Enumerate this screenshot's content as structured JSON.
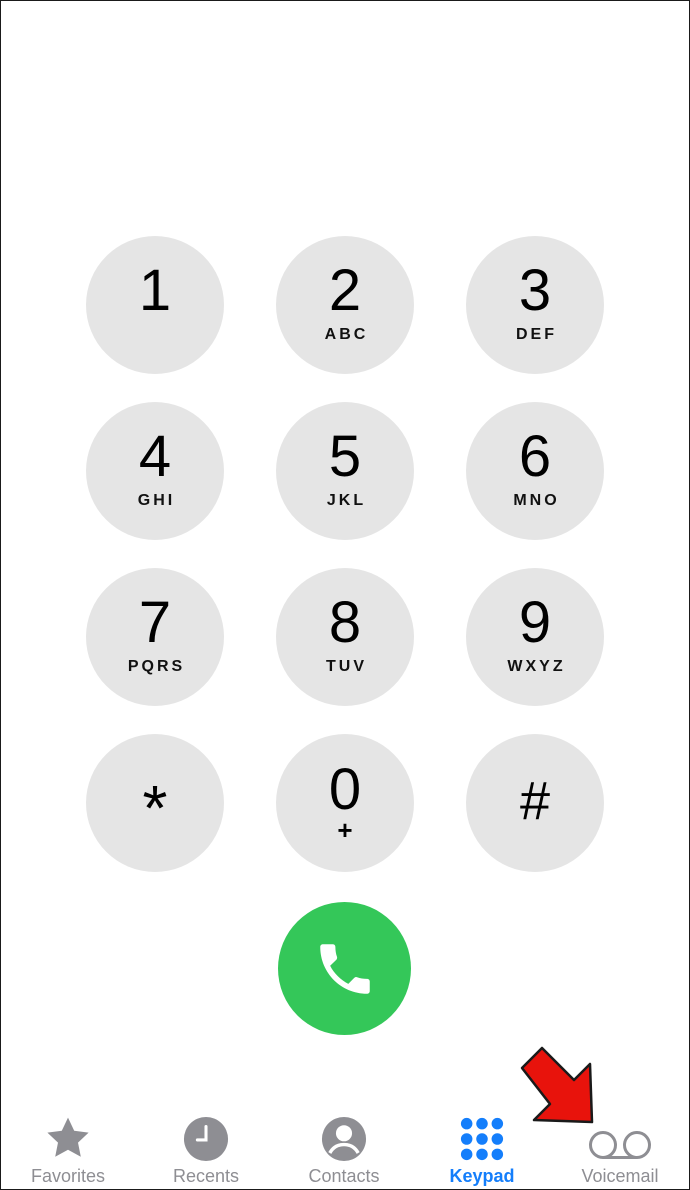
{
  "keypad": {
    "keys": [
      {
        "digit": "1",
        "letters": ""
      },
      {
        "digit": "2",
        "letters": "ABC"
      },
      {
        "digit": "3",
        "letters": "DEF"
      },
      {
        "digit": "4",
        "letters": "GHI"
      },
      {
        "digit": "5",
        "letters": "JKL"
      },
      {
        "digit": "6",
        "letters": "MNO"
      },
      {
        "digit": "7",
        "letters": "PQRS"
      },
      {
        "digit": "8",
        "letters": "TUV"
      },
      {
        "digit": "9",
        "letters": "WXYZ"
      },
      {
        "digit": "*",
        "letters": ""
      },
      {
        "digit": "0",
        "letters": "+"
      },
      {
        "digit": "#",
        "letters": ""
      }
    ]
  },
  "call_button": {
    "icon": "phone-icon",
    "color": "#34c759"
  },
  "tabbar": {
    "tabs": [
      {
        "label": "Favorites",
        "icon": "star-icon",
        "active": false
      },
      {
        "label": "Recents",
        "icon": "clock-icon",
        "active": false
      },
      {
        "label": "Contacts",
        "icon": "person-circle-icon",
        "active": false
      },
      {
        "label": "Keypad",
        "icon": "keypad-grid-icon",
        "active": true
      },
      {
        "label": "Voicemail",
        "icon": "voicemail-icon",
        "active": false
      }
    ],
    "active_color": "#147efb",
    "inactive_color": "#8e8e93"
  },
  "annotation": {
    "icon": "red-arrow-icon",
    "color": "#e8130c"
  }
}
